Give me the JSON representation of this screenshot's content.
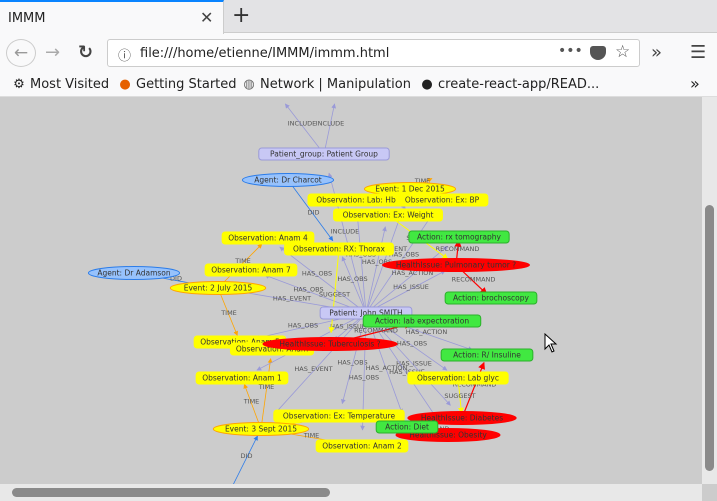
{
  "browser": {
    "tab_title": "IMMM",
    "url": "file:///home/etienne/IMMM/immm.html",
    "bookmarks": [
      "Most Visited",
      "Getting Started",
      "Network | Manipulation",
      "create-react-app/READ..."
    ]
  },
  "colors": {
    "observation": "#ffff00",
    "event": "#ffff00",
    "event_border": "#ffa500",
    "action": "#41e841",
    "health_issue": "#ff0000",
    "agent": "#97c2fc",
    "patient": "#c8c8f5",
    "edge": "#9a9ad8",
    "edge_time": "#ffa500",
    "edge_did": "#2b7ce9"
  },
  "graph": {
    "nodes": [
      {
        "id": "pg",
        "type": "patient",
        "label": "Patient_group: Patient Group"
      },
      {
        "id": "charcot",
        "type": "agent",
        "label": "Agent: Dr Charcot"
      },
      {
        "id": "e1dec",
        "type": "event",
        "label": "Event: 1 Dec 2015"
      },
      {
        "id": "hb",
        "type": "observation",
        "label": "Observation: Lab: Hb"
      },
      {
        "id": "bp",
        "type": "observation",
        "label": "Observation: Ex: BP"
      },
      {
        "id": "weight",
        "type": "observation",
        "label": "Observation: Ex: Weight"
      },
      {
        "id": "rx",
        "type": "observation",
        "label": "Observation: RX: Thorax"
      },
      {
        "id": "anam4",
        "type": "observation",
        "label": "Observation: Anam 4"
      },
      {
        "id": "tomo",
        "type": "action",
        "label": "Action: rx tomography"
      },
      {
        "id": "tumor",
        "type": "health_issue",
        "label": "HealthIssue: Pulmonary tumor ?"
      },
      {
        "id": "anam7",
        "type": "observation",
        "label": "Observation: Anam 7"
      },
      {
        "id": "adamson",
        "type": "agent",
        "label": "Agent: Dr Adamson"
      },
      {
        "id": "e2jul",
        "type": "event",
        "label": "Event: 2 July 2015"
      },
      {
        "id": "broncho",
        "type": "action",
        "label": "Action: brochoscopy"
      },
      {
        "id": "patient",
        "type": "patient",
        "label": "Patient: John SMITH"
      },
      {
        "id": "expect",
        "type": "action",
        "label": "Action: lab expectoration"
      },
      {
        "id": "anam5",
        "type": "observation",
        "label": "Observation: Anam 5"
      },
      {
        "id": "anam3",
        "type": "observation",
        "label": "Observation: Anam"
      },
      {
        "id": "tb",
        "type": "health_issue",
        "label": "HealthIssue: Tuberculosis ?"
      },
      {
        "id": "insuline",
        "type": "action",
        "label": "Action: R/ Insuline"
      },
      {
        "id": "anam1",
        "type": "observation",
        "label": "Observation: Anam 1"
      },
      {
        "id": "glyc",
        "type": "observation",
        "label": "Observation: Lab glyc"
      },
      {
        "id": "obs",
        "type": "observation",
        "label": "Obs"
      },
      {
        "id": "temp",
        "type": "observation",
        "label": "Observation: Ex: Temperature"
      },
      {
        "id": "e3sep",
        "type": "event",
        "label": "Event: 3 Sept 2015"
      },
      {
        "id": "diabetes",
        "type": "health_issue",
        "label": "HealthIssue: Diabetes"
      },
      {
        "id": "obesity",
        "type": "health_issue",
        "label": "HealthIssue: Obesity"
      },
      {
        "id": "diet",
        "type": "action",
        "label": "Action: Diet"
      },
      {
        "id": "anam2",
        "type": "observation",
        "label": "Observation: Anam 2"
      }
    ],
    "edges": [
      {
        "from": "pg",
        "to": "top1",
        "label": "INCLUDE",
        "kind": "edge"
      },
      {
        "from": "pg",
        "to": "top2",
        "label": "INCLUDE",
        "kind": "edge"
      },
      {
        "from": "patient",
        "to": "pg",
        "label": "INCLUDE",
        "kind": "edge"
      },
      {
        "from": "charcot",
        "to": "rx",
        "label": "DID",
        "kind": "did"
      },
      {
        "from": "adamson",
        "to": "e2jul",
        "label": "DID",
        "kind": "did"
      },
      {
        "from": "bot",
        "to": "e3sep",
        "label": "DID",
        "kind": "did"
      },
      {
        "from": "e1dec",
        "to": "e1dec",
        "label": "TIME",
        "kind": "time"
      },
      {
        "from": "e2jul",
        "to": "anam4",
        "label": "TIME",
        "kind": "time"
      },
      {
        "from": "e2jul",
        "to": "anam5",
        "label": "TIME",
        "kind": "time"
      },
      {
        "from": "e3sep",
        "to": "anam1",
        "label": "TIME",
        "kind": "time"
      },
      {
        "from": "e3sep",
        "to": "anam3",
        "label": "TIME",
        "kind": "time"
      },
      {
        "from": "e3sep",
        "to": "temp",
        "label": "TIME",
        "kind": "time"
      },
      {
        "from": "e3sep",
        "to": "anam2",
        "label": "TIME",
        "kind": "time"
      },
      {
        "from": "patient",
        "to": "e1dec",
        "label": "HAS_EVENT",
        "kind": "edge"
      },
      {
        "from": "patient",
        "to": "e2jul",
        "label": "HAS_EVENT",
        "kind": "edge"
      },
      {
        "from": "patient",
        "to": "e3sep",
        "label": "HAS_EVENT",
        "kind": "edge"
      },
      {
        "from": "patient",
        "to": "hb",
        "label": "HAS_OBS",
        "kind": "edge"
      },
      {
        "from": "patient",
        "to": "bp",
        "label": "HAS_OBS",
        "kind": "edge"
      },
      {
        "from": "patient",
        "to": "weight",
        "label": "HAS_OBS",
        "kind": "edge"
      },
      {
        "from": "patient",
        "to": "rx",
        "label": "HAS_OBS",
        "kind": "edge"
      },
      {
        "from": "patient",
        "to": "anam4",
        "label": "HAS_OBS",
        "kind": "edge"
      },
      {
        "from": "patient",
        "to": "anam7",
        "label": "HAS_OBS",
        "kind": "edge"
      },
      {
        "from": "patient",
        "to": "anam5",
        "label": "HAS_OBS",
        "kind": "edge"
      },
      {
        "from": "patient",
        "to": "anam1",
        "label": "HAS_OBS",
        "kind": "edge"
      },
      {
        "from": "patient",
        "to": "temp",
        "label": "HAS_OBS",
        "kind": "edge"
      },
      {
        "from": "patient",
        "to": "anam2",
        "label": "HAS_OBS",
        "kind": "edge"
      },
      {
        "from": "patient",
        "to": "glyc",
        "label": "HAS_OBS",
        "kind": "edge"
      },
      {
        "from": "patient",
        "to": "tumor",
        "label": "HAS_ISSUE",
        "kind": "edge"
      },
      {
        "from": "patient",
        "to": "tb",
        "label": "HAS_ISSUE",
        "kind": "edge"
      },
      {
        "from": "patient",
        "to": "diabetes",
        "label": "HAS_ISSUE",
        "kind": "edge"
      },
      {
        "from": "patient",
        "to": "obesity",
        "label": "HAS_ISSUE",
        "kind": "edge"
      },
      {
        "from": "patient",
        "to": "tomo",
        "label": "HAS_ACTION",
        "kind": "edge"
      },
      {
        "from": "patient",
        "to": "insuline",
        "label": "HAS_ACTION",
        "kind": "edge"
      },
      {
        "from": "patient",
        "to": "diet",
        "label": "HAS_ACTION",
        "kind": "edge"
      },
      {
        "from": "tumor",
        "to": "tomo",
        "label": "RECOMMAND",
        "kind": "red"
      },
      {
        "from": "tumor",
        "to": "broncho",
        "label": "RECOMMAND",
        "kind": "red"
      },
      {
        "from": "tb",
        "to": "expect",
        "label": "RECOMMAND",
        "kind": "red"
      },
      {
        "from": "diabetes",
        "to": "insuline",
        "label": "RECOMMAND",
        "kind": "red"
      },
      {
        "from": "obesity",
        "to": "diet",
        "label": "RECOMMAND",
        "kind": "red"
      },
      {
        "from": "rx",
        "to": "tb",
        "label": "SUGGEST",
        "kind": "suggest"
      },
      {
        "from": "anam3",
        "to": "tb",
        "label": "SUGGEST",
        "kind": "suggest"
      },
      {
        "from": "glyc",
        "to": "diabetes",
        "label": "SUGGEST",
        "kind": "suggest"
      },
      {
        "from": "weight",
        "to": "tumor",
        "label": "SUGGEST",
        "kind": "suggest"
      }
    ]
  }
}
